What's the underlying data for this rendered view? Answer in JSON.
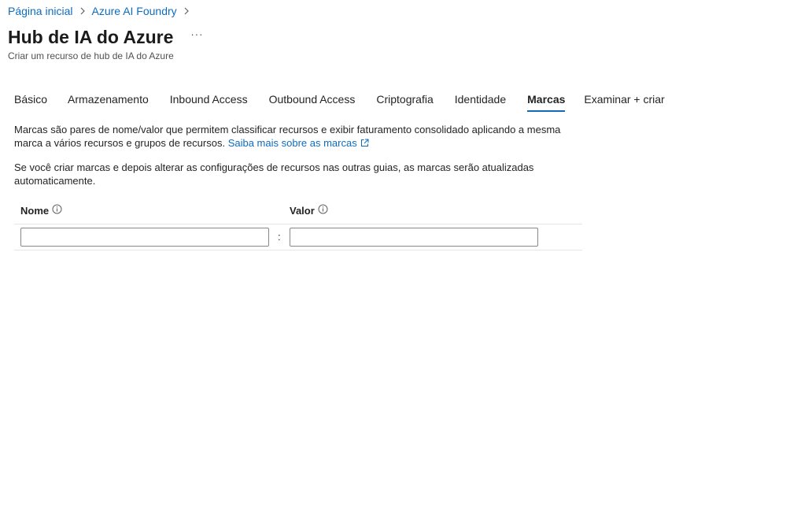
{
  "breadcrumb": {
    "items": [
      {
        "label": "Página inicial"
      },
      {
        "label": "Azure AI Foundry"
      }
    ]
  },
  "header": {
    "title": "Hub de IA do Azure",
    "more_label": "···",
    "subtitle": "Criar um recurso de hub de IA do Azure"
  },
  "tabs": [
    {
      "label": "Básico",
      "active": false
    },
    {
      "label": "Armazenamento",
      "active": false
    },
    {
      "label": "Inbound Access",
      "active": false
    },
    {
      "label": "Outbound Access",
      "active": false
    },
    {
      "label": "Criptografia",
      "active": false
    },
    {
      "label": "Identidade",
      "active": false
    },
    {
      "label": "Marcas",
      "active": true
    },
    {
      "label": "Examinar + criar",
      "active": false
    }
  ],
  "content": {
    "description_1": "Marcas são pares de nome/valor que permitem classificar recursos e exibir faturamento consolidado aplicando a mesma marca a vários recursos e grupos de recursos.",
    "learn_more_link": "Saiba mais sobre as marcas",
    "description_2": "Se você criar marcas e depois alterar as configurações de recursos nas outras guias, as marcas serão atualizadas automaticamente."
  },
  "tag_table": {
    "name_header": "Nome",
    "value_header": "Valor",
    "separator": ":",
    "rows": [
      {
        "name": "",
        "value": ""
      }
    ]
  },
  "colors": {
    "link": "#0f6cbd",
    "active_tab_underline": "#0f6cbd",
    "text": "#242424"
  },
  "icons": {
    "breadcrumb_separator": "chevron-right-icon",
    "external_link": "external-link-icon",
    "info": "info-icon"
  }
}
